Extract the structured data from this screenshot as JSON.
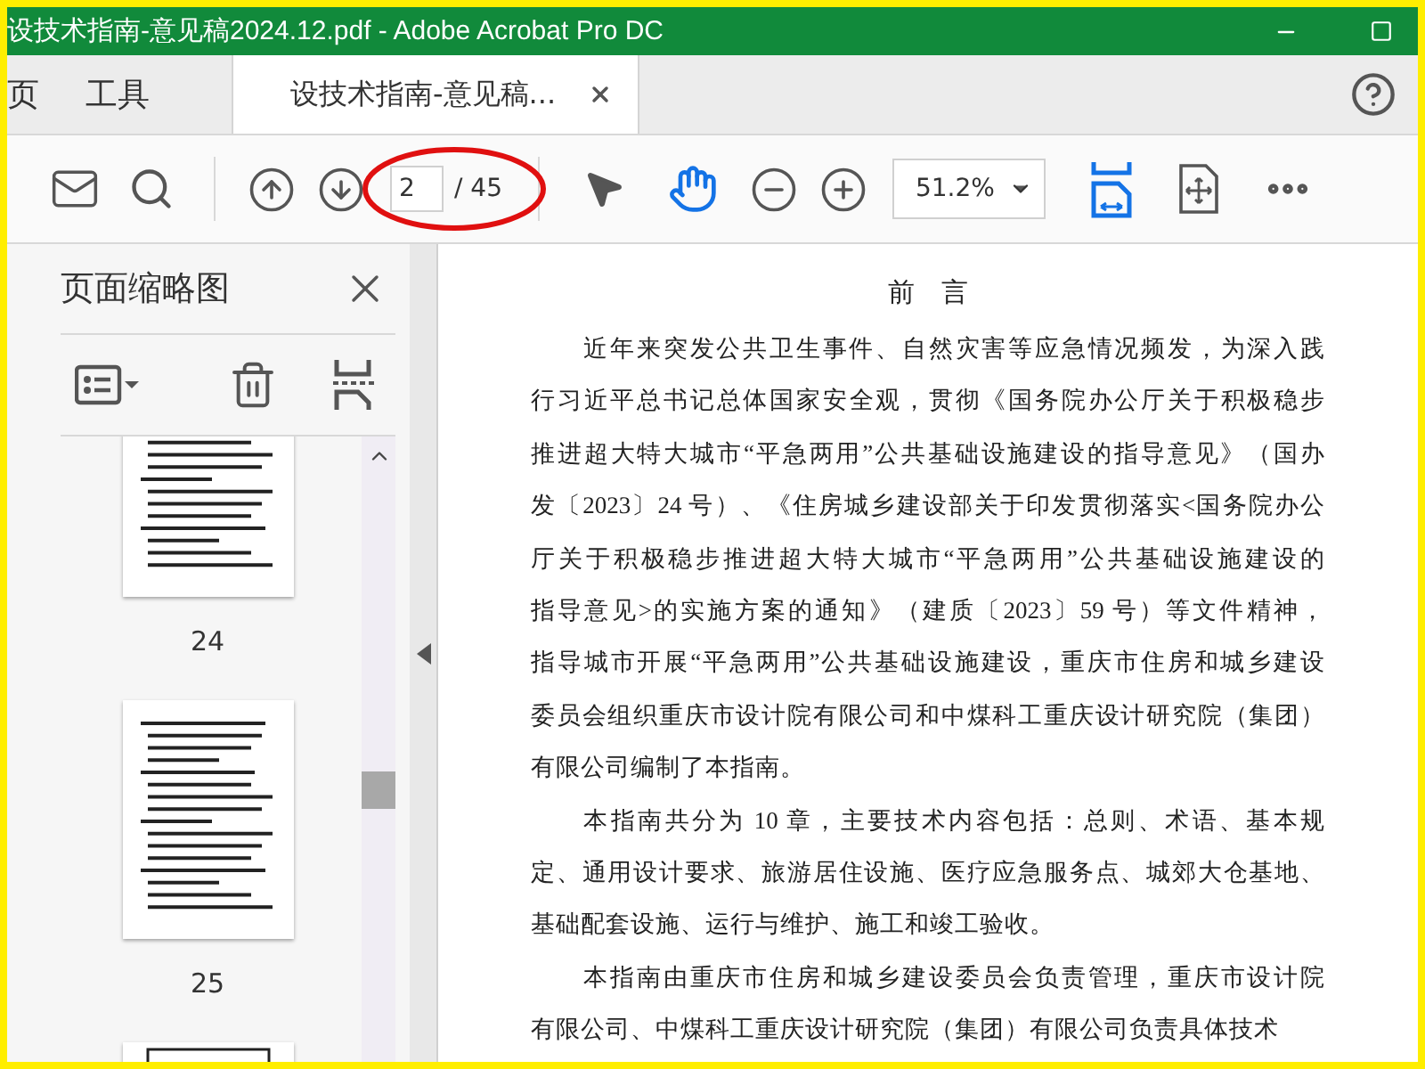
{
  "window": {
    "title": "设技术指南-意见稿2024.12.pdf - Adobe Acrobat Pro DC"
  },
  "nav": [
    {
      "label": "页"
    },
    {
      "label": "工具"
    }
  ],
  "tabs": [
    {
      "label": "设技术指南-意见稿...",
      "selected": true
    }
  ],
  "toolbar": {
    "page_value": "2",
    "page_total": "/ 45",
    "zoom": "51.2%",
    "tools": [
      {
        "kind": "select",
        "selected": false
      },
      {
        "kind": "hand",
        "selected": true
      }
    ]
  },
  "sidebar": {
    "title": "页面缩略图",
    "thumbnails": [
      {
        "label": "24"
      },
      {
        "label": "25"
      }
    ]
  },
  "document": {
    "heading": "前　言",
    "paragraphs": [
      {
        "lines": [
          "近年来突发公共卫生事件、自然灾害等应急情况频发，为深入践",
          "行习近平总书记总体国家安全观，贯彻《国务院办公厅关于积极稳步",
          "推进超大特大城市“平急两用”公共基础设施建设的指导意见》（国办",
          "发〔2023〕24 号）、《住房城乡建设部关于印发贯彻落实<国务院办公",
          "厅关于积极稳步推进超大特大城市“平急两用”公共基础设施建设的",
          "指导意见>的实施方案的通知》（建质〔2023〕59 号）等文件精神，",
          "指导城市开展“平急两用”公共基础设施建设，重庆市住房和城乡建设",
          "委员会组织重庆市设计院有限公司和中煤科工重庆设计研究院（集团）",
          "有限公司编制了本指南。"
        ]
      },
      {
        "lines": [
          "本指南共分为 10 章，主要技术内容包括：总则、术语、基本规",
          "定、通用设计要求、旅游居住设施、医疗应急服务点、城郊大仓基地、",
          "基础配套设施、运行与维护、施工和竣工验收。"
        ]
      },
      {
        "lines": [
          "本指南由重庆市住房和城乡建设委员会负责管理，重庆市设计院",
          "有限公司、中煤科工重庆设计研究院（集团）有限公司负责具体技术"
        ]
      }
    ]
  }
}
